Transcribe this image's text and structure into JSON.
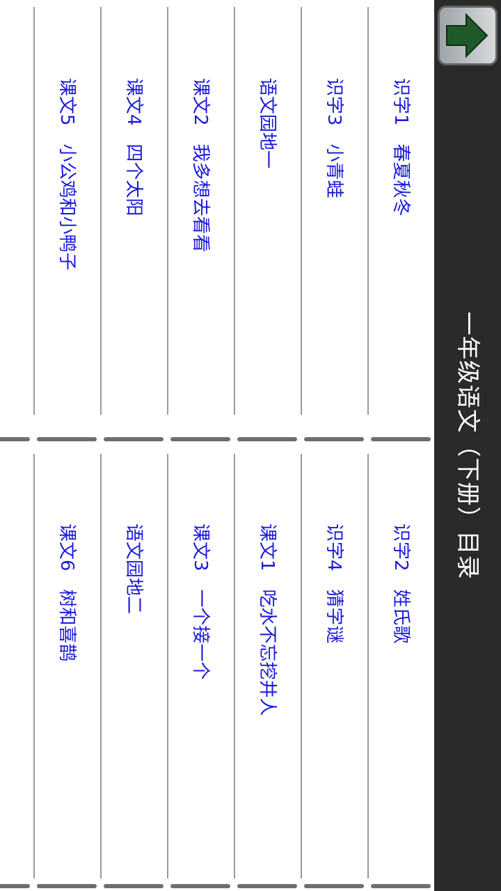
{
  "header": {
    "title": "一年级语文（下册）目录",
    "home_icon": "home-up-arrow-icon"
  },
  "columns": [
    {
      "items": [
        {
          "label": "识字1　春夏秋冬"
        },
        {
          "label": "识字3　小青蛙"
        },
        {
          "label": "语文园地一"
        },
        {
          "label": "课文2　我多想去看看"
        },
        {
          "label": "课文4　四个太阳"
        },
        {
          "label": "课文5　小公鸡和小鸭子"
        }
      ]
    },
    {
      "items": [
        {
          "label": "识字2　姓氏歌"
        },
        {
          "label": "识字4　猜字谜"
        },
        {
          "label": "课文1　吃水不忘挖井人"
        },
        {
          "label": "课文3　一个接一个"
        },
        {
          "label": "语文园地二"
        },
        {
          "label": "课文6　树和喜鹊"
        }
      ]
    }
  ],
  "colors": {
    "header_bg": "#2a2b29",
    "link_text": "#1a1adb",
    "divider": "#7a7a7a"
  }
}
